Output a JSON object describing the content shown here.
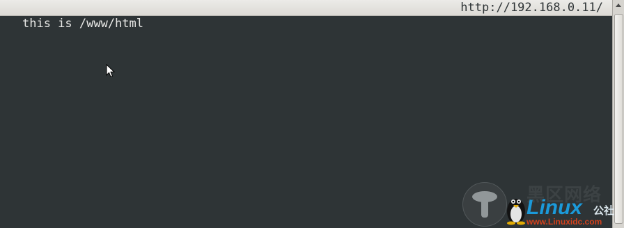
{
  "topbar": {
    "url": "http://192.168.0.11/"
  },
  "page": {
    "text": "this is /www/html"
  },
  "watermark": {
    "chinese_title": "黑区网络",
    "brand": "Linux",
    "brand_suffix": "公社",
    "url": "www.Linuxidc.com"
  },
  "icons": {
    "cursor": "mouse-pointer-icon",
    "scroll_up": "arrow-up-icon",
    "logo": "tux-penguin-icon"
  },
  "colors": {
    "background": "#2e3436",
    "text": "#e8e8e6",
    "brand_blue": "#1aa3e8",
    "url_red": "#e0431a"
  }
}
